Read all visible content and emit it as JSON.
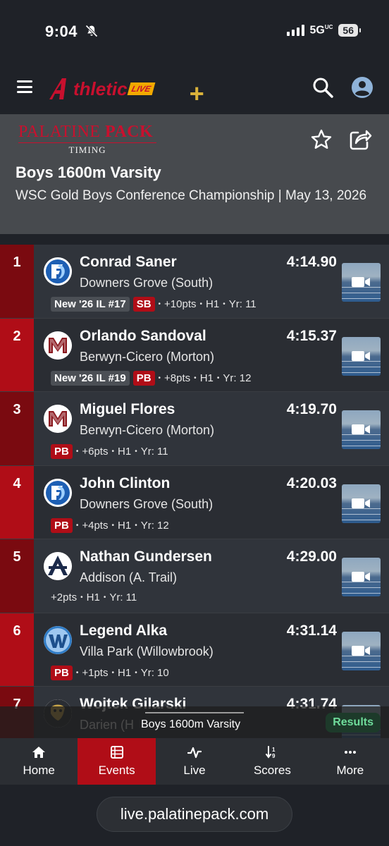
{
  "status": {
    "time": "9:04",
    "network": "5G",
    "network_sup": "UC",
    "battery": "56"
  },
  "header": {
    "logo_text": "thletic",
    "logo_live": "LIVE",
    "plus": "+"
  },
  "event": {
    "org_logo_top_a": "PALATINE ",
    "org_logo_top_b": "PACK",
    "org_logo_sub": "TIMING",
    "title": "Boys 1600m Varsity",
    "subtitle": "WSC Gold Boys Conference Championship | May 13, 2026"
  },
  "results": [
    {
      "place": "1",
      "name": "Conrad Saner",
      "team": "Downers Grove (South)",
      "time": "4:14.90",
      "rank": "New '26 IL #17",
      "badge": "SB",
      "pts": "+10pts",
      "heat": "H1",
      "yr": "Yr: 11",
      "logo": "downers-grove-south-logo"
    },
    {
      "place": "2",
      "name": "Orlando Sandoval",
      "team": "Berwyn-Cicero (Morton)",
      "time": "4:15.37",
      "rank": "New '26 IL #19",
      "badge": "PB",
      "pts": "+8pts",
      "heat": "H1",
      "yr": "Yr: 12",
      "logo": "morton-logo"
    },
    {
      "place": "3",
      "name": "Miguel Flores",
      "team": "Berwyn-Cicero (Morton)",
      "time": "4:19.70",
      "rank": "",
      "badge": "PB",
      "pts": "+6pts",
      "heat": "H1",
      "yr": "Yr: 11",
      "logo": "morton-logo"
    },
    {
      "place": "4",
      "name": "John Clinton",
      "team": "Downers Grove (South)",
      "time": "4:20.03",
      "rank": "",
      "badge": "PB",
      "pts": "+4pts",
      "heat": "H1",
      "yr": "Yr: 12",
      "logo": "downers-grove-south-logo"
    },
    {
      "place": "5",
      "name": "Nathan Gundersen",
      "team": "Addison (A. Trail)",
      "time": "4:29.00",
      "rank": "",
      "badge": "",
      "pts": "+2pts",
      "heat": "H1",
      "yr": "Yr: 11",
      "logo": "addison-trail-logo"
    },
    {
      "place": "6",
      "name": "Legend Alka",
      "team": "Villa Park (Willowbrook)",
      "time": "4:31.14",
      "rank": "",
      "badge": "PB",
      "pts": "+1pts",
      "heat": "H1",
      "yr": "Yr: 10",
      "logo": "willowbrook-logo"
    },
    {
      "place": "7",
      "name": "Wojtek Gilarski",
      "team": "Darien (H",
      "time": "4:31.74",
      "rank": "",
      "badge": "",
      "pts": "",
      "heat": "",
      "yr": "",
      "logo": "darien-logo"
    }
  ],
  "now_bar": {
    "title": "Boys 1600m Varsity",
    "button": "Results"
  },
  "nav": [
    {
      "label": "Home",
      "icon": "home-icon"
    },
    {
      "label": "Events",
      "icon": "list-icon"
    },
    {
      "label": "Live",
      "icon": "pulse-icon"
    },
    {
      "label": "Scores",
      "icon": "sort-icon"
    },
    {
      "label": "More",
      "icon": "more-icon"
    }
  ],
  "browser": {
    "url": "live.palatinepack.com"
  },
  "colors": {
    "accent": "#b00d17",
    "accent_dark": "#7a0a10",
    "background": "#1f2228",
    "header_panel": "#474a4e"
  }
}
